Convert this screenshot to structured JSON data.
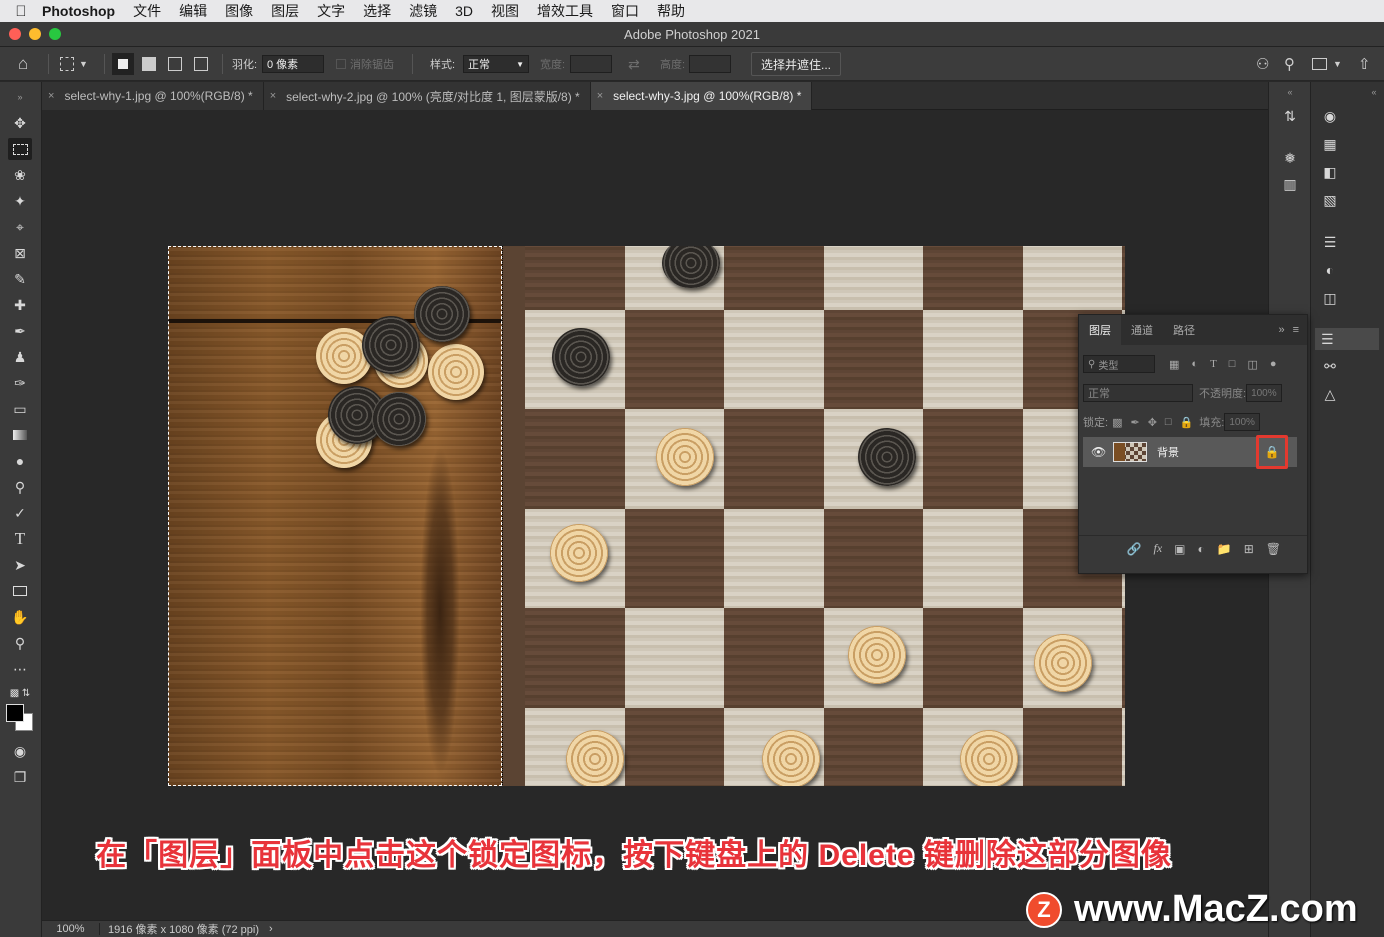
{
  "menubar": {
    "app_name": "Photoshop",
    "items": [
      "文件",
      "编辑",
      "图像",
      "图层",
      "文字",
      "选择",
      "滤镜",
      "3D",
      "视图",
      "增效工具",
      "窗口",
      "帮助"
    ]
  },
  "window": {
    "title": "Adobe Photoshop 2021"
  },
  "options": {
    "feather_label": "羽化:",
    "feather_value": "0 像素",
    "antialias_label": "消除锯齿",
    "style_label": "样式:",
    "style_value": "正常",
    "width_label": "宽度:",
    "height_label": "高度:",
    "select_mask_button": "选择并遮住..."
  },
  "tabs": [
    {
      "label": "select-why-1.jpg @ 100%(RGB/8) *",
      "active": false
    },
    {
      "label": "select-why-2.jpg @ 100% (亮度/对比度 1, 图层蒙版/8) *",
      "active": false
    },
    {
      "label": "select-why-3.jpg @ 100%(RGB/8) *",
      "active": true
    }
  ],
  "layers_panel": {
    "tabs": [
      "图层",
      "通道",
      "路径"
    ],
    "filter_kind": "类型",
    "blend_mode": "正常",
    "opacity_label": "不透明度:",
    "opacity_value": "100%",
    "lock_label": "锁定:",
    "fill_label": "填充:",
    "fill_value": "100%",
    "layer_name": "背景"
  },
  "status": {
    "zoom": "100%",
    "doc_info": "1916 像素 x 1080 像素 (72 ppi)"
  },
  "caption": "在「图层」面板中点击这个锁定图标，按下键盘上的 Delete 键删除这部分图像",
  "watermark": {
    "letter": "Z",
    "text": "www.MacZ.com"
  },
  "colors": {
    "caption_red": "#e8333a",
    "highlight_red": "#e3392f",
    "watermark_orange": "#f04c2d"
  }
}
